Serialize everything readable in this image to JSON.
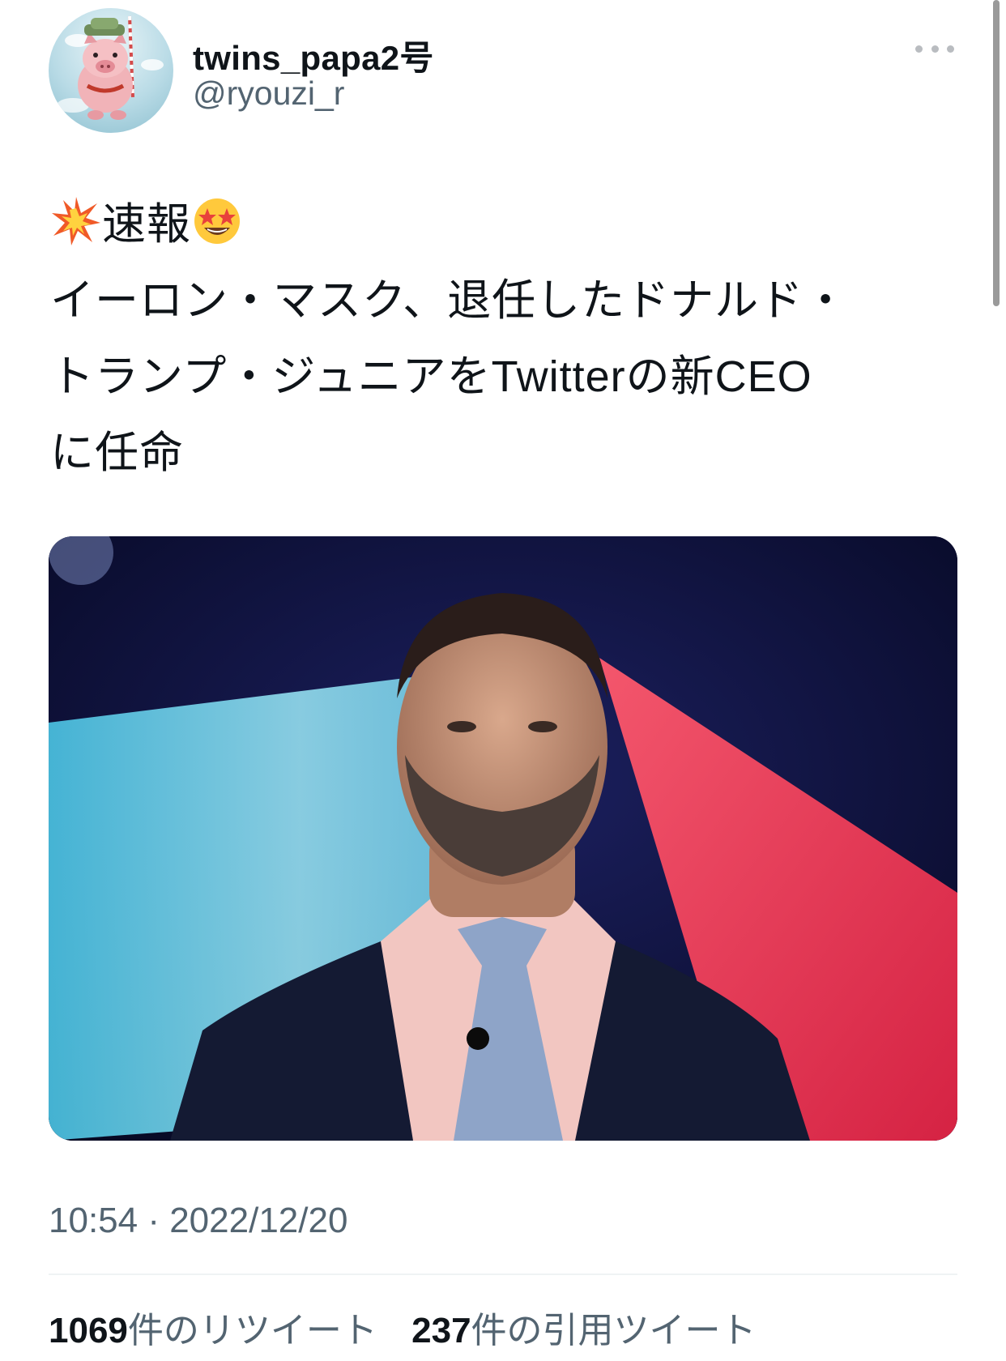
{
  "user": {
    "display_name": "twins_papa2号",
    "handle": "@ryouzi_r",
    "avatar_icon": "pig-character-avatar"
  },
  "more_icon": "more-options-icon",
  "tweet": {
    "headline_emoji_1": "collision-emoji",
    "headline_text": "速報",
    "headline_emoji_2": "star-struck-emoji",
    "line_1": "イーロン・マスク、退任したドナルド・",
    "line_2": "トランプ・ジュニアをTwitterの新CEO",
    "line_3": "に任命"
  },
  "media": {
    "description_icon": "photo-man-in-suit"
  },
  "timestamp": "10:54 · 2022/12/20",
  "stats": {
    "retweets_count": "1069",
    "retweets_label": "件のリツイート",
    "quotes_count": "237",
    "quotes_label": "件の引用ツイート"
  },
  "colors": {
    "text_primary": "#0f1419",
    "text_secondary": "#536471",
    "divider": "#eff3f4"
  }
}
